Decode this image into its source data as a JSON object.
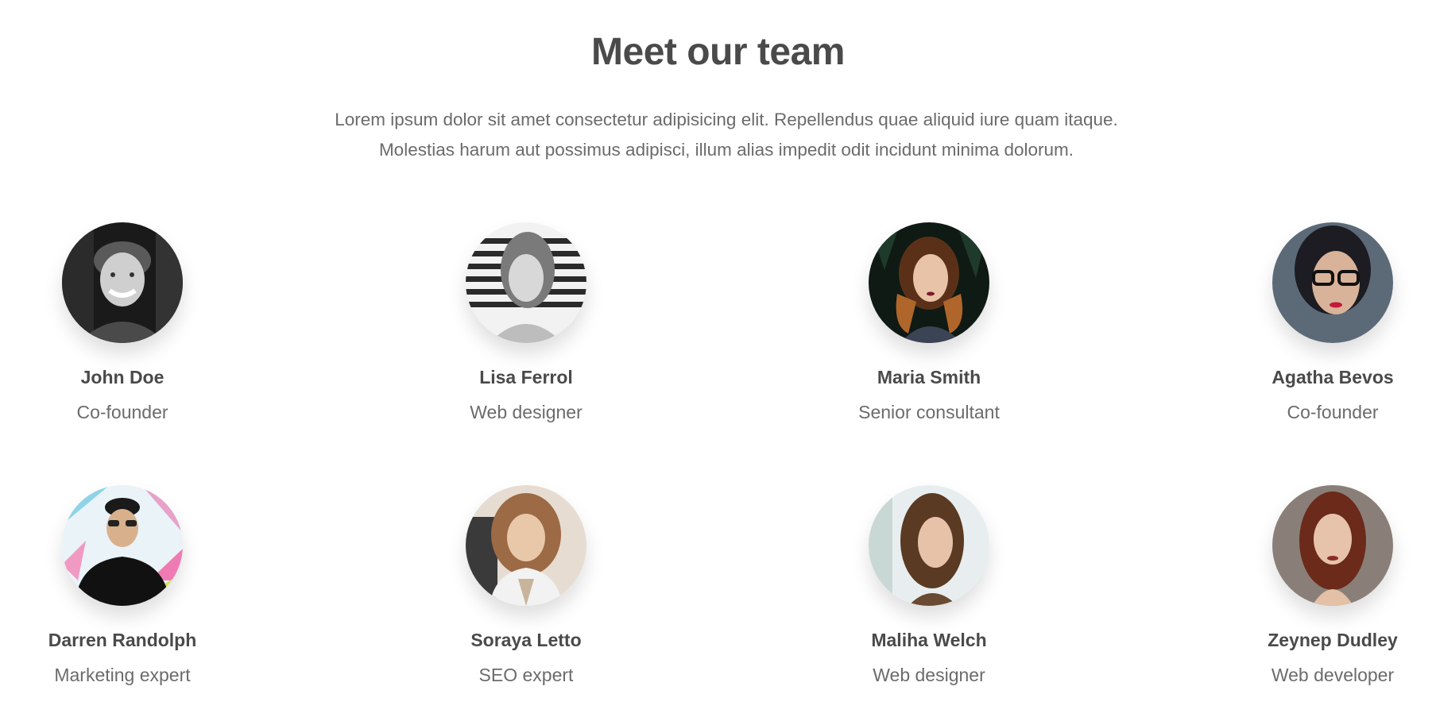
{
  "section": {
    "title": "Meet our team",
    "intro": "Lorem ipsum dolor sit amet consectetur adipisicing elit. Repellendus quae aliquid iure quam itaque. Molestias harum aut possimus adipisci, illum alias impedit odit incidunt minima dolorum."
  },
  "team": [
    {
      "name": "John Doe",
      "role": "Co-founder"
    },
    {
      "name": "Lisa Ferrol",
      "role": "Web designer"
    },
    {
      "name": "Maria Smith",
      "role": "Senior consultant"
    },
    {
      "name": "Agatha Bevos",
      "role": "Co-founder"
    },
    {
      "name": "Darren Randolph",
      "role": "Marketing expert"
    },
    {
      "name": "Soraya Letto",
      "role": "SEO expert"
    },
    {
      "name": "Maliha Welch",
      "role": "Web designer"
    },
    {
      "name": "Zeynep Dudley",
      "role": "Web developer"
    }
  ],
  "colors": {
    "heading": "#4a4a4a",
    "body_text": "#6b6b6b",
    "background": "#ffffff"
  }
}
